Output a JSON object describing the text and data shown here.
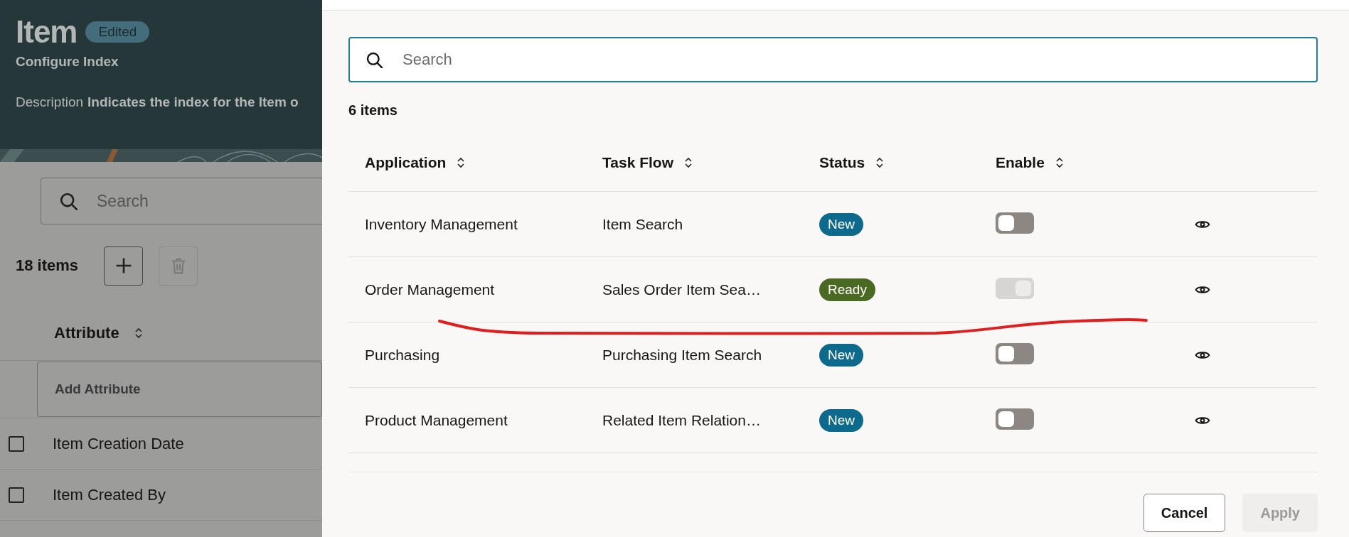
{
  "page": {
    "title": "Item",
    "badge": "Edited",
    "subtitle": "Configure Index",
    "description_label": "Description",
    "description": "Indicates the index for the Item o",
    "search": {
      "placeholder": "Search"
    },
    "count": "18 items",
    "table": {
      "columns": [
        {
          "label": "Attribute"
        }
      ],
      "add_field": {
        "placeholder": "Add Attribute"
      },
      "rows": [
        {
          "attribute": "Item Creation Date",
          "checked": false
        },
        {
          "attribute": "Item Created By",
          "checked": false
        }
      ]
    }
  },
  "drawer": {
    "search": {
      "placeholder": "Search"
    },
    "count": "6 items",
    "table": {
      "columns": [
        {
          "label": "Application"
        },
        {
          "label": "Task Flow"
        },
        {
          "label": "Status"
        },
        {
          "label": "Enable"
        }
      ],
      "rows": [
        {
          "application": "Inventory Management",
          "task_flow": "Item Search",
          "status": "New",
          "color": "#0d6a8c",
          "enabled": false,
          "disabled": false
        },
        {
          "application": "Order Management",
          "task_flow": "Sales Order Item Sea…",
          "status": "Ready",
          "color": "#4a6a24",
          "enabled": true,
          "disabled": true
        },
        {
          "application": "Purchasing",
          "task_flow": "Purchasing Item Search",
          "status": "New",
          "color": "#0d6a8c",
          "enabled": false,
          "disabled": false
        },
        {
          "application": "Product Management",
          "task_flow": "Related Item Relation…",
          "status": "New",
          "color": "#0d6a8c",
          "enabled": false,
          "disabled": false
        }
      ]
    },
    "buttons": [
      {
        "label": "Cancel",
        "disabled": false
      },
      {
        "label": "Apply",
        "disabled": true
      }
    ]
  }
}
